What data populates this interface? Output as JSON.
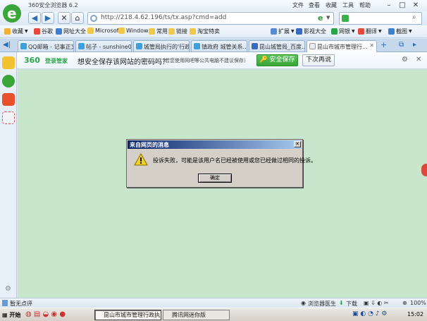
{
  "window": {
    "title": "360安全浏览器 6.2",
    "menu": [
      "文件",
      "查看",
      "收藏",
      "工具",
      "帮助"
    ]
  },
  "nav": {
    "address": "http://218.4.62.196/ts/tx.asp?cmd=add",
    "search_placeholder": ""
  },
  "favorites_bar": {
    "left_items": [
      "收藏",
      "谷歌",
      "网址大全",
      "Microsoft",
      "Windows",
      "常用",
      "链接",
      "淘宝特卖"
    ],
    "right_items": [
      "扩展",
      "影视大全",
      "网银",
      "翻译",
      "截图"
    ]
  },
  "tabs": [
    {
      "label": "QQ邮箱 - 记事正文"
    },
    {
      "label": "帖子 - sunshine010"
    },
    {
      "label": "城管局执行的'行政..."
    },
    {
      "label": "镇政府 城管关系..."
    },
    {
      "label": "昆山城管局_百度..."
    },
    {
      "label": "昆山市城市管理行..."
    }
  ],
  "password_bar": {
    "logo": "360",
    "logo_sub": "登录管家",
    "question": "想安全保存该网站的密码吗？",
    "note": "（若您使用网吧等公共电脑不建议保存）",
    "save_label": "安全保存",
    "later_label": "下次再说"
  },
  "dialog": {
    "title": "来自网页的消息",
    "message": "投诉失败，可能是该用户名已经被使用或您已经做过相同的投诉。",
    "ok_label": "确定"
  },
  "status_bar": {
    "text": "暂无点评",
    "doctor": "浏览器医生",
    "download": "下载",
    "zoom": "100%"
  },
  "taskbar": {
    "start_label": "开始",
    "items": [
      {
        "label": "昆山市城市管理行政执..."
      },
      {
        "label": "腾讯网迷你版"
      }
    ],
    "clock": "15:02"
  },
  "colors": {
    "content_bg": "#c8e6cb",
    "accent_green": "#3aa63a",
    "dialog_title": "#0a246a"
  }
}
